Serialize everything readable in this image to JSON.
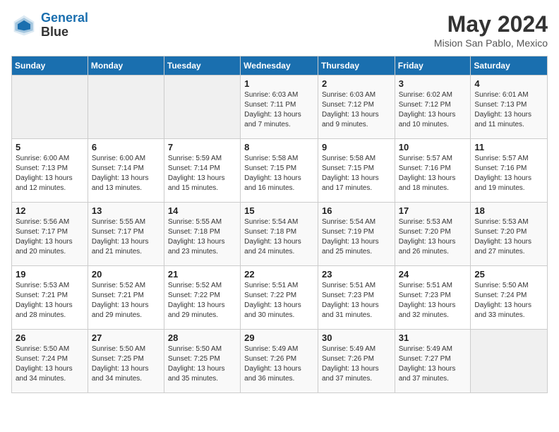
{
  "header": {
    "logo_line1": "General",
    "logo_line2": "Blue",
    "title": "May 2024",
    "subtitle": "Mision San Pablo, Mexico"
  },
  "weekdays": [
    "Sunday",
    "Monday",
    "Tuesday",
    "Wednesday",
    "Thursday",
    "Friday",
    "Saturday"
  ],
  "weeks": [
    [
      {
        "day": "",
        "info": ""
      },
      {
        "day": "",
        "info": ""
      },
      {
        "day": "",
        "info": ""
      },
      {
        "day": "1",
        "info": "Sunrise: 6:03 AM\nSunset: 7:11 PM\nDaylight: 13 hours and 7 minutes."
      },
      {
        "day": "2",
        "info": "Sunrise: 6:03 AM\nSunset: 7:12 PM\nDaylight: 13 hours and 9 minutes."
      },
      {
        "day": "3",
        "info": "Sunrise: 6:02 AM\nSunset: 7:12 PM\nDaylight: 13 hours and 10 minutes."
      },
      {
        "day": "4",
        "info": "Sunrise: 6:01 AM\nSunset: 7:13 PM\nDaylight: 13 hours and 11 minutes."
      }
    ],
    [
      {
        "day": "5",
        "info": "Sunrise: 6:00 AM\nSunset: 7:13 PM\nDaylight: 13 hours and 12 minutes."
      },
      {
        "day": "6",
        "info": "Sunrise: 6:00 AM\nSunset: 7:14 PM\nDaylight: 13 hours and 13 minutes."
      },
      {
        "day": "7",
        "info": "Sunrise: 5:59 AM\nSunset: 7:14 PM\nDaylight: 13 hours and 15 minutes."
      },
      {
        "day": "8",
        "info": "Sunrise: 5:58 AM\nSunset: 7:15 PM\nDaylight: 13 hours and 16 minutes."
      },
      {
        "day": "9",
        "info": "Sunrise: 5:58 AM\nSunset: 7:15 PM\nDaylight: 13 hours and 17 minutes."
      },
      {
        "day": "10",
        "info": "Sunrise: 5:57 AM\nSunset: 7:16 PM\nDaylight: 13 hours and 18 minutes."
      },
      {
        "day": "11",
        "info": "Sunrise: 5:57 AM\nSunset: 7:16 PM\nDaylight: 13 hours and 19 minutes."
      }
    ],
    [
      {
        "day": "12",
        "info": "Sunrise: 5:56 AM\nSunset: 7:17 PM\nDaylight: 13 hours and 20 minutes."
      },
      {
        "day": "13",
        "info": "Sunrise: 5:55 AM\nSunset: 7:17 PM\nDaylight: 13 hours and 21 minutes."
      },
      {
        "day": "14",
        "info": "Sunrise: 5:55 AM\nSunset: 7:18 PM\nDaylight: 13 hours and 23 minutes."
      },
      {
        "day": "15",
        "info": "Sunrise: 5:54 AM\nSunset: 7:18 PM\nDaylight: 13 hours and 24 minutes."
      },
      {
        "day": "16",
        "info": "Sunrise: 5:54 AM\nSunset: 7:19 PM\nDaylight: 13 hours and 25 minutes."
      },
      {
        "day": "17",
        "info": "Sunrise: 5:53 AM\nSunset: 7:20 PM\nDaylight: 13 hours and 26 minutes."
      },
      {
        "day": "18",
        "info": "Sunrise: 5:53 AM\nSunset: 7:20 PM\nDaylight: 13 hours and 27 minutes."
      }
    ],
    [
      {
        "day": "19",
        "info": "Sunrise: 5:53 AM\nSunset: 7:21 PM\nDaylight: 13 hours and 28 minutes."
      },
      {
        "day": "20",
        "info": "Sunrise: 5:52 AM\nSunset: 7:21 PM\nDaylight: 13 hours and 29 minutes."
      },
      {
        "day": "21",
        "info": "Sunrise: 5:52 AM\nSunset: 7:22 PM\nDaylight: 13 hours and 29 minutes."
      },
      {
        "day": "22",
        "info": "Sunrise: 5:51 AM\nSunset: 7:22 PM\nDaylight: 13 hours and 30 minutes."
      },
      {
        "day": "23",
        "info": "Sunrise: 5:51 AM\nSunset: 7:23 PM\nDaylight: 13 hours and 31 minutes."
      },
      {
        "day": "24",
        "info": "Sunrise: 5:51 AM\nSunset: 7:23 PM\nDaylight: 13 hours and 32 minutes."
      },
      {
        "day": "25",
        "info": "Sunrise: 5:50 AM\nSunset: 7:24 PM\nDaylight: 13 hours and 33 minutes."
      }
    ],
    [
      {
        "day": "26",
        "info": "Sunrise: 5:50 AM\nSunset: 7:24 PM\nDaylight: 13 hours and 34 minutes."
      },
      {
        "day": "27",
        "info": "Sunrise: 5:50 AM\nSunset: 7:25 PM\nDaylight: 13 hours and 34 minutes."
      },
      {
        "day": "28",
        "info": "Sunrise: 5:50 AM\nSunset: 7:25 PM\nDaylight: 13 hours and 35 minutes."
      },
      {
        "day": "29",
        "info": "Sunrise: 5:49 AM\nSunset: 7:26 PM\nDaylight: 13 hours and 36 minutes."
      },
      {
        "day": "30",
        "info": "Sunrise: 5:49 AM\nSunset: 7:26 PM\nDaylight: 13 hours and 37 minutes."
      },
      {
        "day": "31",
        "info": "Sunrise: 5:49 AM\nSunset: 7:27 PM\nDaylight: 13 hours and 37 minutes."
      },
      {
        "day": "",
        "info": ""
      }
    ]
  ]
}
